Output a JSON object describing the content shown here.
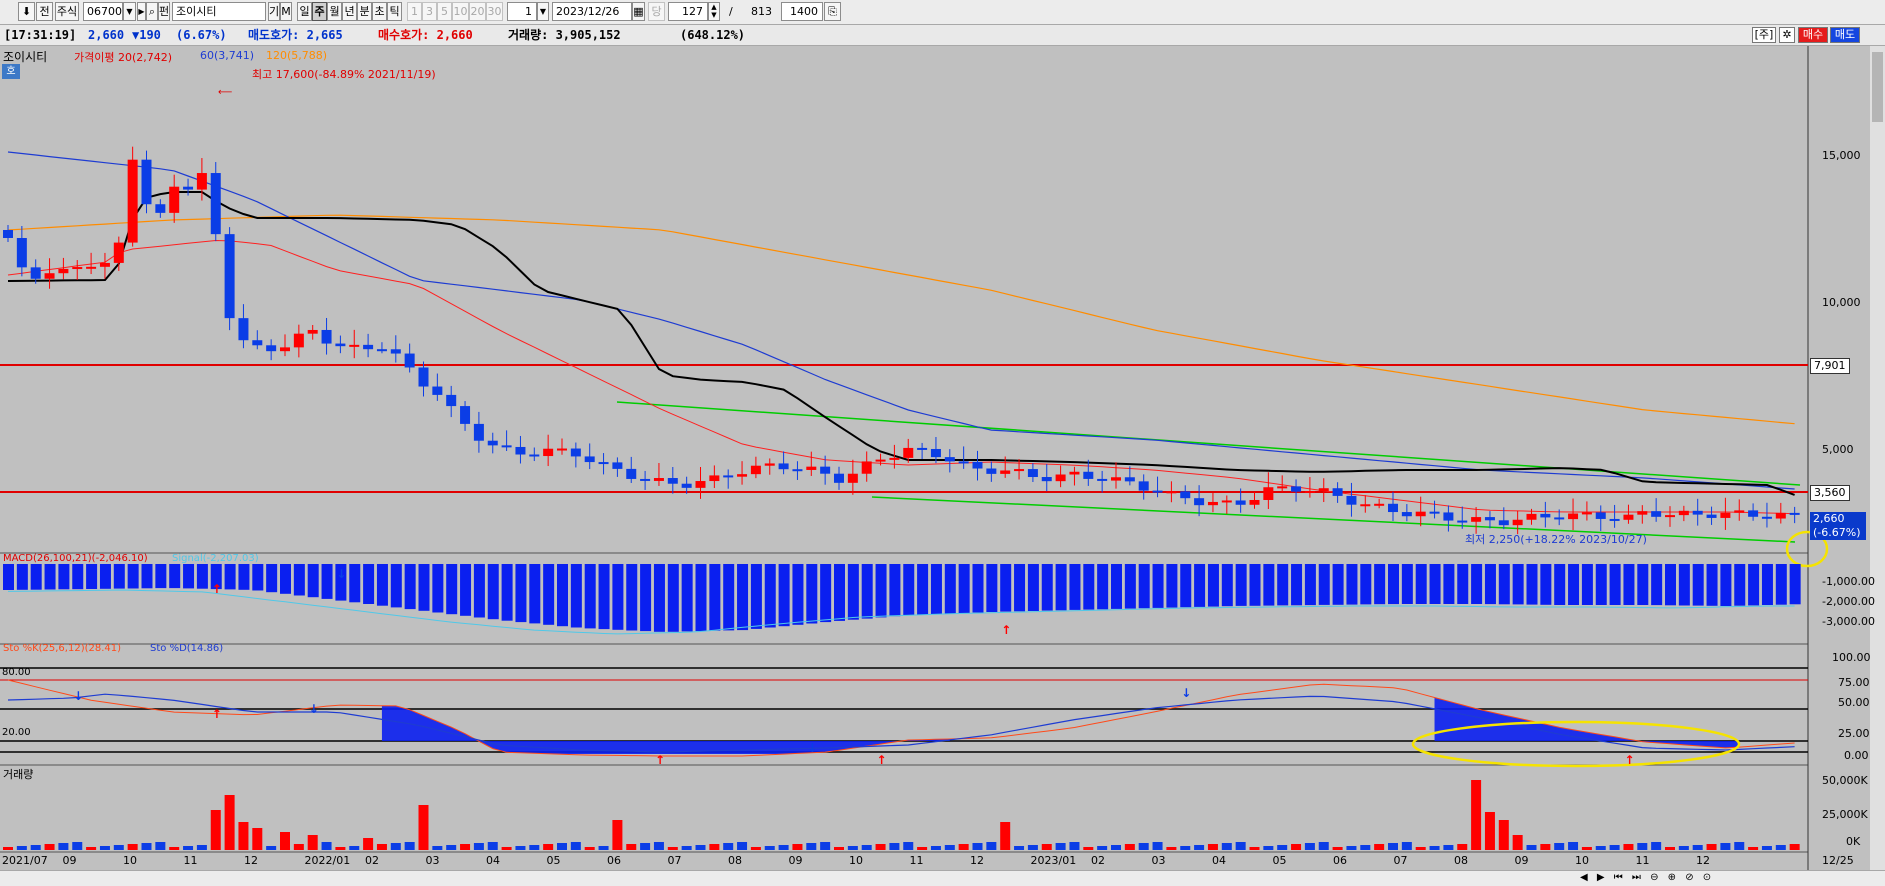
{
  "toolbar": {
    "jeon": "전",
    "market": "주식",
    "code": "067000",
    "fund_btn": "펀",
    "name": "조이시티",
    "gi": "기",
    "m": "M",
    "periods": [
      "일",
      "주",
      "월",
      "년",
      "분",
      "초",
      "틱"
    ],
    "active_period": "주",
    "minute_presets": [
      "1",
      "3",
      "5",
      "10",
      "20",
      "30"
    ],
    "interval": "1",
    "date": "2023/12/26",
    "dang": "당",
    "count": "127",
    "slash": "/",
    "total": "813",
    "bars": "1400"
  },
  "info": {
    "time": "[17:31:19]",
    "price": "2,660",
    "change": "▼190",
    "pct": "(6.67%)",
    "ask_label": "매도호가: 2,665",
    "bid_label": "매수호가: 2,660",
    "volume_label": "거래량: 3,905,152",
    "volume_pct": "(648.12%)",
    "btn_ju": "[주]",
    "btn_buy": "매수",
    "btn_sell": "매도"
  },
  "price_panel": {
    "legend_name": "조이시티",
    "legend_ma20": "가격이평 20(2,742)",
    "legend_ma60": "60(3,741)",
    "legend_ma120": "120(5,788)",
    "badge": "호",
    "high_annotation": "최고 17,600(-84.89% 2021/11/19)",
    "low_annotation": "최저 2,250(+18.22% 2023/10/27)",
    "axis_labels": [
      "15,000",
      "10,000",
      "5,000"
    ],
    "hline_tags": [
      "7,901",
      "3,560"
    ],
    "last_tag": "2,660",
    "last_pct": "(-6.67%)"
  },
  "macd_panel": {
    "legend_macd": "MACD(26,100,21)(-2,046.10)",
    "legend_signal": "Signal(-2,207.03)",
    "axis_labels": [
      "-1,000.00",
      "-2,000.00",
      "-3,000.00"
    ]
  },
  "sto_panel": {
    "legend_k": "Sto %K(25,6,12)(28.41)",
    "legend_d": "Sto %D(14.86)",
    "level80": "80.00",
    "level20": "20.00",
    "axis_labels": [
      "100.00",
      "75.00",
      "50.00",
      "25.00",
      "0.00"
    ]
  },
  "volume_panel": {
    "title": "거래량",
    "axis_labels": [
      "50,000K",
      "25,000K",
      "0K"
    ]
  },
  "x_axis": [
    "2021/07",
    "09",
    "10",
    "11",
    "12",
    "2022/01",
    "02",
    "03",
    "04",
    "05",
    "06",
    "07",
    "08",
    "09",
    "10",
    "11",
    "12",
    "2023/01",
    "02",
    "03",
    "04",
    "05",
    "06",
    "07",
    "08",
    "09",
    "10",
    "11",
    "12",
    "12/25"
  ],
  "colors": {
    "up": "#ff0000",
    "down": "#0b3de6",
    "ma20": "#ff0000",
    "ma60": "#1e3cd2",
    "ma120": "#ff8c00",
    "trend": "#00cc00",
    "highlight": "#ffff00"
  },
  "chart_data": {
    "type": "candlestick",
    "interval": "weekly",
    "hlines": [
      7901,
      3560
    ],
    "last_close": 2660
  }
}
